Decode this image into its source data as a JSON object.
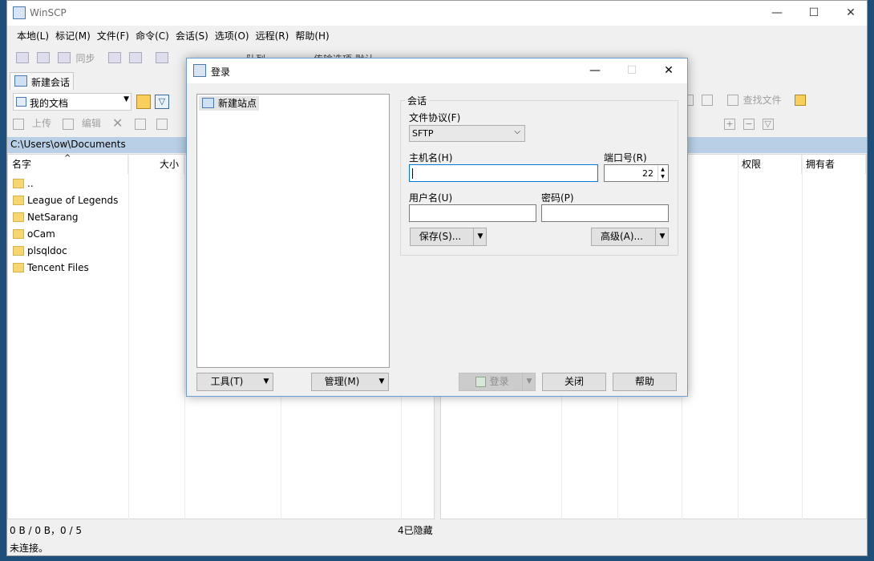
{
  "app": {
    "title": "WinSCP"
  },
  "window_controls": {
    "minimize": "—",
    "maximize": "☐",
    "close": "✕"
  },
  "menu": [
    "本地(L)",
    "标记(M)",
    "文件(F)",
    "命令(C)",
    "会话(S)",
    "选项(O)",
    "远程(R)",
    "帮助(H)"
  ],
  "toolbar": {
    "sync_label": "同步",
    "queue_label": "队列",
    "transfer_options_label": "传输选项 默认"
  },
  "session_tab": {
    "label": "新建会话"
  },
  "local": {
    "drive_label": "我的文档",
    "actions": {
      "upload": "上传",
      "edit": "编辑"
    },
    "path": "C:\\Users\\ow\\Documents",
    "columns": {
      "name": "名字",
      "size": "大小"
    },
    "files": [
      {
        "name": ".."
      },
      {
        "name": "League of Legends"
      },
      {
        "name": "NetSarang"
      },
      {
        "name": "oCam"
      },
      {
        "name": "plsqldoc"
      },
      {
        "name": "Tencent Files"
      }
    ]
  },
  "remote": {
    "find_files_label": "查找文件",
    "columns": {
      "rights": "权限",
      "owner": "拥有者"
    }
  },
  "status": {
    "selection": "0 B / 0 B，0 / 5",
    "hidden": "4已隐藏",
    "connection": "未连接。"
  },
  "login_dialog": {
    "title": "登录",
    "site_new": "新建站点",
    "session_group": "会话",
    "protocol_label": "文件协议(F)",
    "protocol_value": "SFTP",
    "host_label": "主机名(H)",
    "host_value": "",
    "port_label": "端口号(R)",
    "port_value": "22",
    "user_label": "用户名(U)",
    "user_value": "",
    "password_label": "密码(P)",
    "password_value": "",
    "save_button": "保存(S)...",
    "advanced_button": "高级(A)...",
    "tools_button": "工具(T)",
    "manage_button": "管理(M)",
    "login_button": "登录",
    "close_button": "关闭",
    "help_button": "帮助"
  }
}
